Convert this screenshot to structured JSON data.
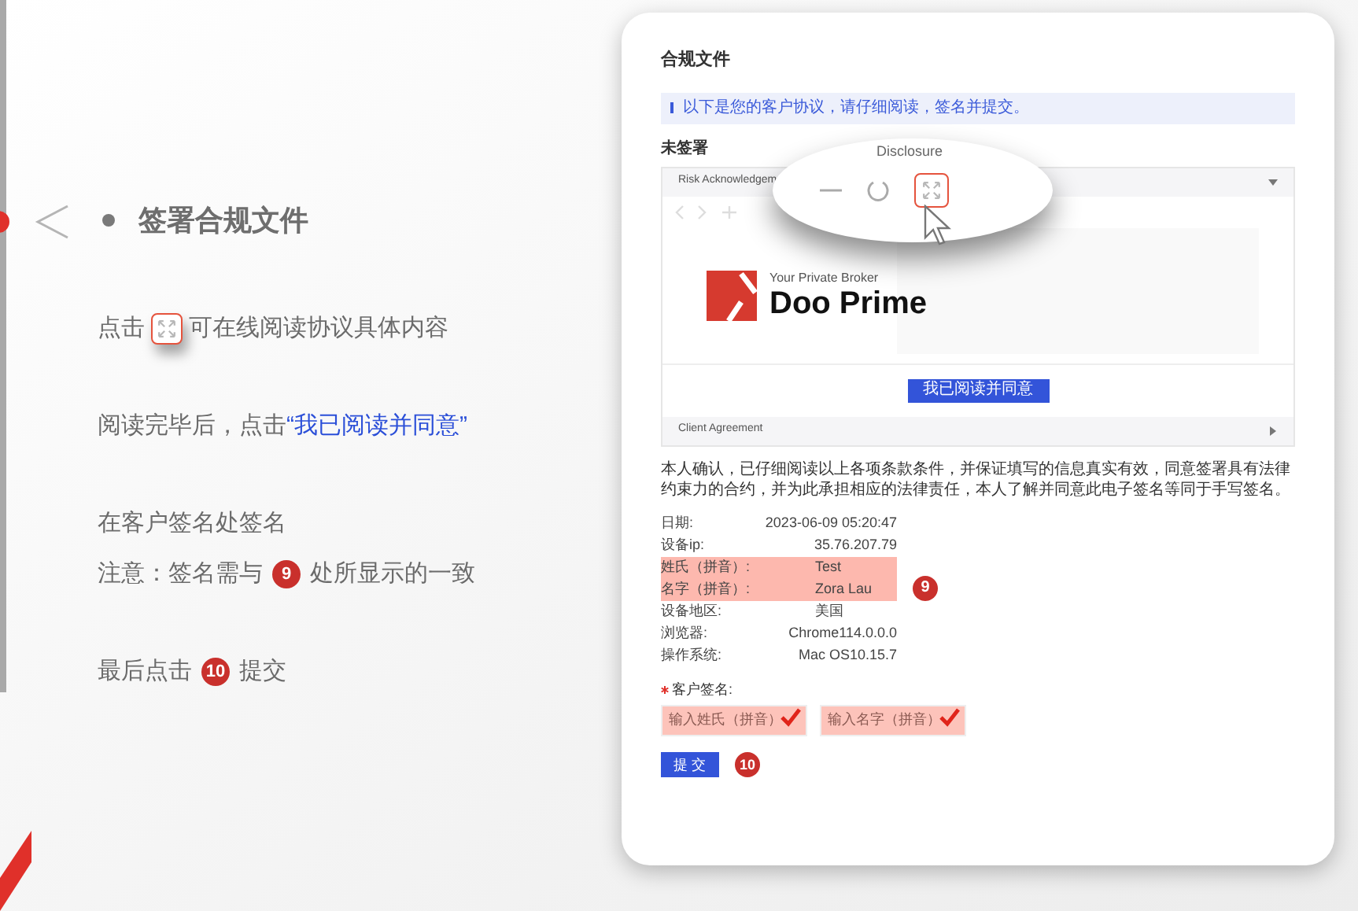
{
  "slide": {
    "title": "签署合规文件",
    "steps": [
      {
        "lines": [
          [
            {
              "kind": "text",
              "text": "点击"
            },
            {
              "kind": "icon"
            },
            {
              "kind": "text",
              "text": "可在线阅读协议具体内容"
            }
          ]
        ]
      },
      {
        "lines": [
          [
            {
              "kind": "text",
              "text": "阅读完毕后，点击"
            },
            {
              "kind": "highlight",
              "text": "“我已阅读并同意”"
            }
          ]
        ]
      },
      {
        "lines": [
          [
            {
              "kind": "text",
              "text": "在客户签名处签名"
            }
          ],
          [
            {
              "kind": "text",
              "text": "注意：签名需与"
            },
            {
              "kind": "badge",
              "text": "9"
            },
            {
              "kind": "text",
              "text": "处所显示的一致"
            }
          ]
        ]
      },
      {
        "lines": [
          [
            {
              "kind": "text",
              "text": "最后点击"
            },
            {
              "kind": "badge",
              "text": "10"
            },
            {
              "kind": "text",
              "text": "提交"
            }
          ]
        ]
      }
    ]
  },
  "card": {
    "title": "合规文件",
    "notice": "以下是您的客户协议，请仔细阅读，签名并提交。",
    "status": "未签署",
    "accordion": [
      {
        "title": "Risk Acknowledgem",
        "expanded": true
      },
      {
        "title": "Client Agreement",
        "expanded": false
      }
    ],
    "magnifier": {
      "caption": "Disclosure"
    },
    "document": {
      "tagline": "Your Private Broker",
      "brand": "Doo Prime"
    },
    "agree_button": "我已阅读并同意",
    "declaration": "本人确认，已仔细阅读以上各项条款条件，并保证填写的信息真实有效，同意签署具有法律约束力的合约，并为此承担相应的法律责任，本人了解并同意此电子签名等同于手写签名。",
    "details": [
      {
        "label": "日期:",
        "value": "2023-06-09 05:20:47",
        "highlighted": false
      },
      {
        "label": "设备ip:",
        "value": "35.76.207.79",
        "highlighted": false
      },
      {
        "label": "姓氏（拼音）:",
        "value": "Test",
        "highlighted": true
      },
      {
        "label": "名字（拼音）:",
        "value": "Zora Lau",
        "highlighted": true
      },
      {
        "label": "设备地区:",
        "value": "美国",
        "highlighted": false
      },
      {
        "label": "浏览器:",
        "value": "Chrome114.0.0.0",
        "highlighted": false
      },
      {
        "label": "操作系统:",
        "value": "Mac OS10.15.7",
        "highlighted": false
      }
    ],
    "details_badge": "9",
    "signature": {
      "label": "客户签名:",
      "required": true,
      "fields": [
        {
          "placeholder": "输入姓氏（拼音）",
          "checked": true
        },
        {
          "placeholder": "输入名字（拼音）",
          "checked": true
        }
      ]
    },
    "submit": "提 交",
    "submit_badge": "10"
  }
}
